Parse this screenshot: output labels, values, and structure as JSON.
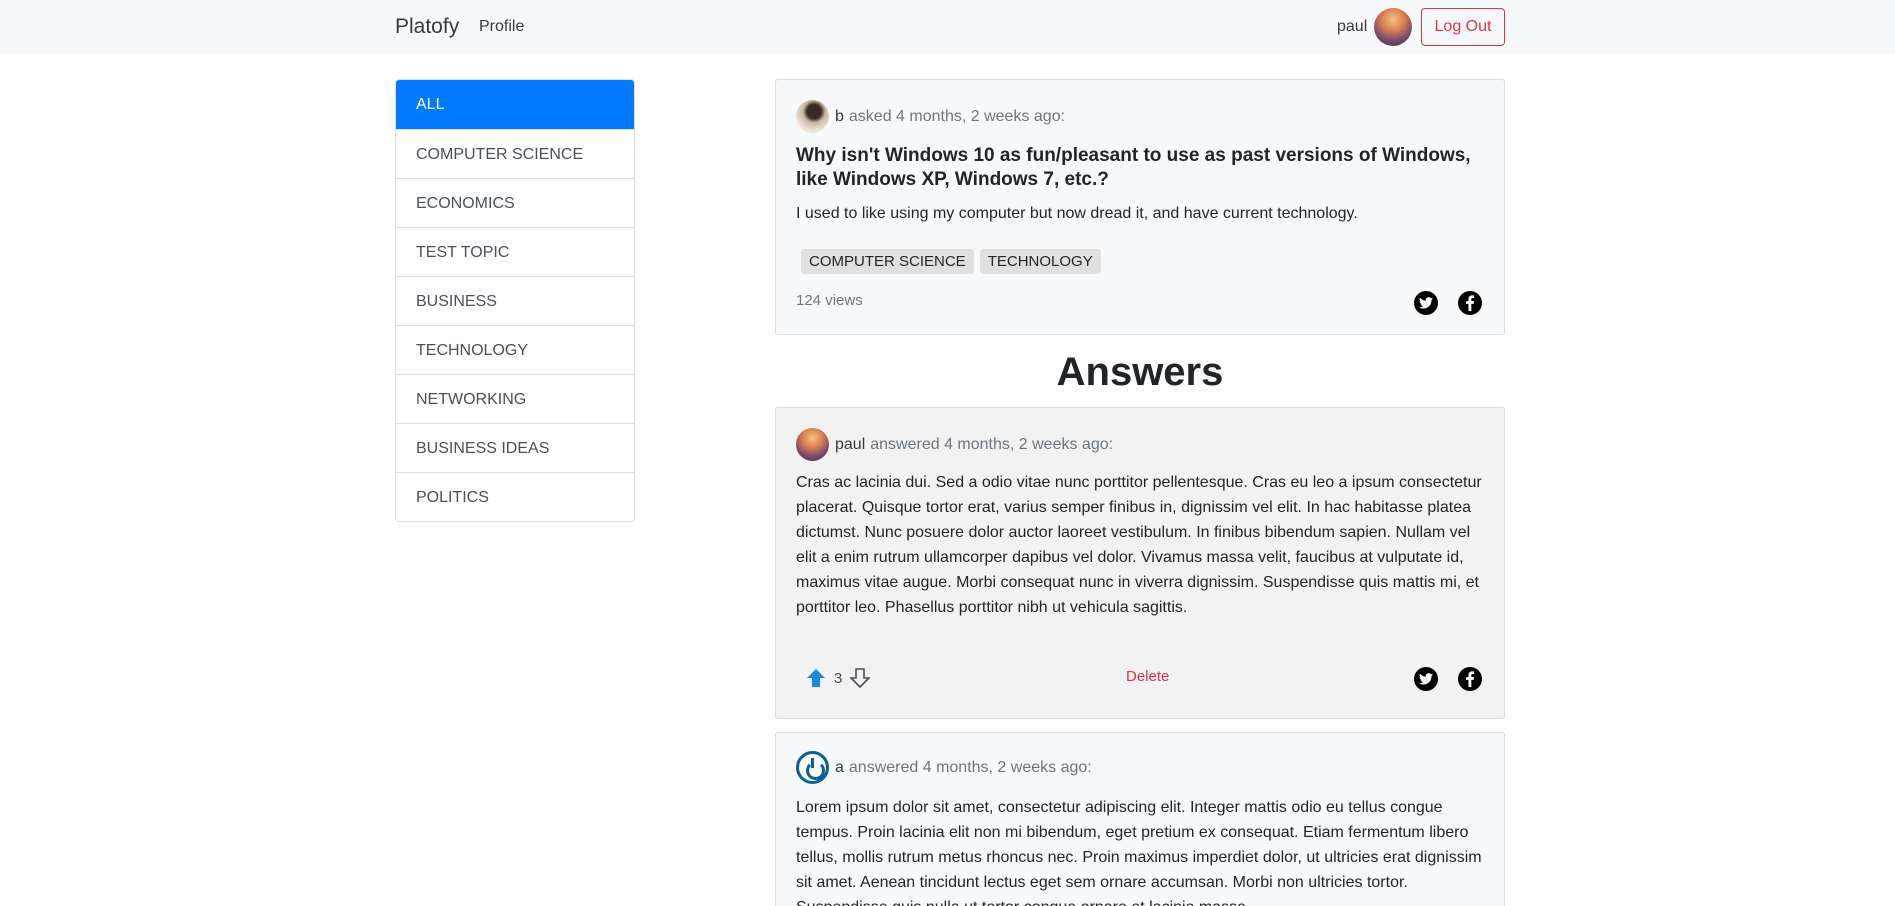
{
  "nav": {
    "brand": "Platofy",
    "profile": "Profile",
    "username": "paul",
    "logout": "Log Out"
  },
  "topics": [
    "ALL",
    "COMPUTER SCIENCE",
    "ECONOMICS",
    "TEST TOPIC",
    "BUSINESS",
    "TECHNOLOGY",
    "NETWORKING",
    "BUSINESS IDEAS",
    "POLITICS"
  ],
  "question": {
    "author": "b",
    "meta": "asked 4 months, 2 weeks ago:",
    "title": "Why isn't Windows 10 as fun/pleasant to use as past versions of Windows, like Windows XP, Windows 7, etc.?",
    "body": "I used to like using my computer but now dread it, and have current technology.",
    "tags": [
      "COMPUTER SCIENCE",
      "TECHNOLOGY"
    ],
    "views": "124 views"
  },
  "answers_heading": "Answers",
  "answers": [
    {
      "author": "paul",
      "meta": "answered 4 months, 2 weeks ago:",
      "body": "Cras ac lacinia dui. Sed a odio vitae nunc porttitor pellentesque. Cras eu leo a ipsum consectetur placerat. Quisque tortor erat, varius semper finibus in, dignissim vel elit. In hac habitasse platea dictumst. Nunc posuere dolor auctor laoreet vestibulum. In finibus bibendum sapien. Nullam vel elit a enim rutrum ullamcorper dapibus vel dolor. Vivamus massa velit, faucibus at vulputate id, maximus vitae augue. Morbi consequat nunc in viverra dignissim. Suspendisse quis mattis mi, et porttitor leo. Phasellus porttitor nibh ut vehicula sagittis.",
      "votes": "3",
      "delete": "Delete"
    },
    {
      "author": "a",
      "meta": "answered 4 months, 2 weeks ago:",
      "body": "Lorem ipsum dolor sit amet, consectetur adipiscing elit. Integer mattis odio eu tellus congue tempus. Proin lacinia elit non mi bibendum, eget pretium ex consequat. Etiam fermentum libero tellus, mollis rutrum metus rhoncus nec. Proin maximus imperdiet dolor, ut ultricies erat dignissim sit amet. Aenean tincidunt lectus eget sem ornare accumsan. Morbi non ultricies tortor. Suspendisse quis nulla ut tortor congue ornare et lacinia massa."
    }
  ],
  "colors": {
    "primary": "#007bff",
    "danger": "#dc3545",
    "navbar": "#f8f9fa"
  }
}
